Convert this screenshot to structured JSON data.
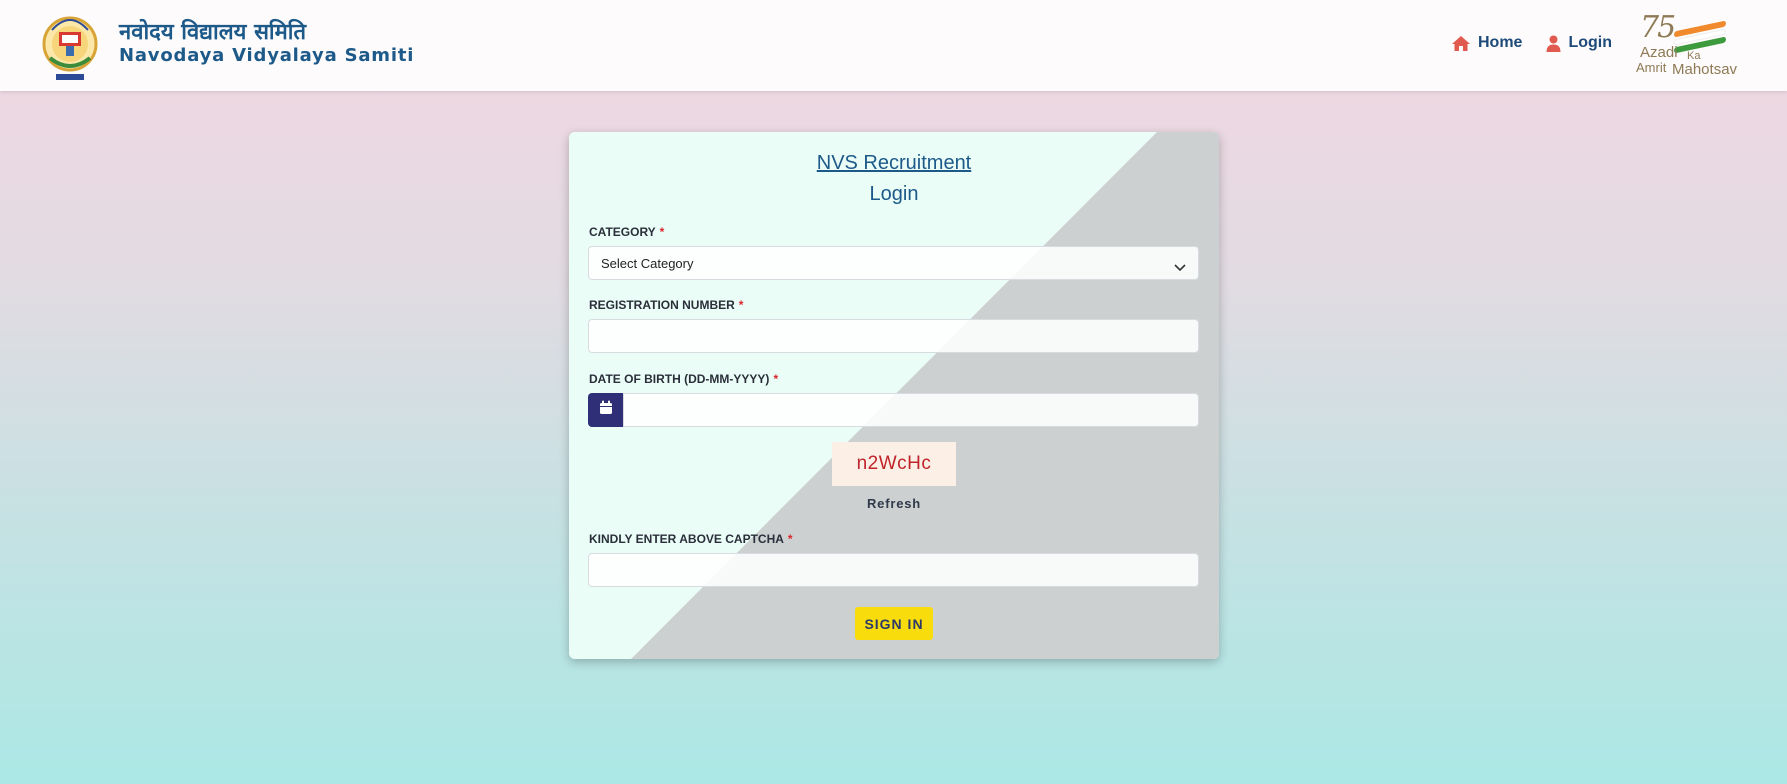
{
  "header": {
    "org_name_hindi": "नवोदय विद्यालय समिति",
    "org_name_english": "Navodaya Vidyalaya Samiti",
    "logo_icon": "nvs-emblem-icon",
    "nav": [
      {
        "label": "Home",
        "icon": "home-icon"
      },
      {
        "label": "Login",
        "icon": "user-icon"
      }
    ],
    "azadi_logo": {
      "number": "75",
      "line1": "Azadi",
      "line2": "Amrit",
      "line3": "Ka",
      "line4": "Mahotsav"
    }
  },
  "card": {
    "title": "NVS Recruitment",
    "subtitle": "Login",
    "category": {
      "label": "CATEGORY",
      "required_mark": "*",
      "selected": "Select Category"
    },
    "registration": {
      "label": "REGISTRATION NUMBER",
      "required_mark": "*",
      "value": ""
    },
    "dob": {
      "label": "DATE OF BIRTH (DD-MM-YYYY)",
      "required_mark": "*",
      "value": "",
      "icon": "calendar-icon"
    },
    "captcha": {
      "code": "n2WcHc",
      "refresh_label": "Refresh"
    },
    "captcha_input": {
      "label": "KINDLY ENTER ABOVE CAPTCHA",
      "required_mark": "*",
      "value": ""
    },
    "signin_label": "SIGN IN"
  },
  "colors": {
    "accent_blue": "#1d5a8a",
    "required_red": "#d9262c",
    "signin_yellow": "#f9dc0b",
    "calendar_navy": "#2e2f77",
    "nav_icon_red": "#e15a4f"
  }
}
